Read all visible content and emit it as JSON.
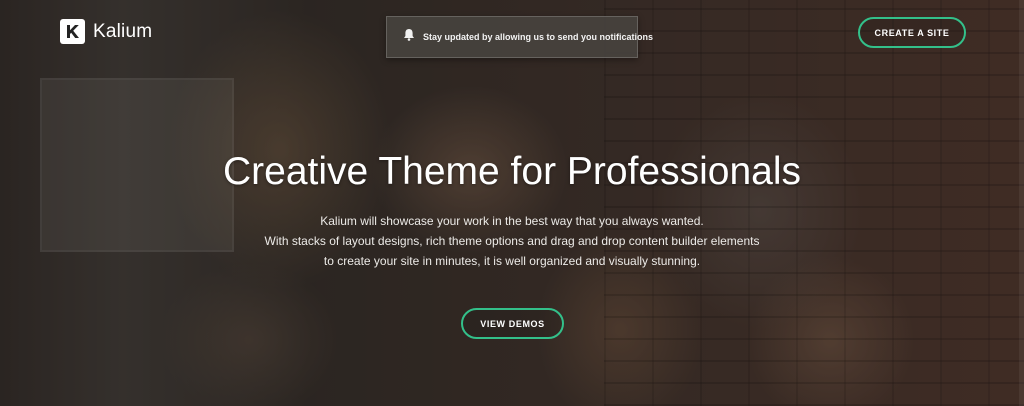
{
  "header": {
    "logo_text": "Kalium",
    "logo_icon": "kalium-k-icon",
    "create_site_label": "CREATE A SITE"
  },
  "notification": {
    "icon": "bell-icon",
    "text": "Stay updated by allowing us to send you notifications"
  },
  "hero": {
    "title": "Creative Theme for Professionals",
    "description_lines": [
      "Kalium will showcase your work in the best way that you always wanted.",
      "With stacks of layout designs, rich theme options and drag and drop content builder elements",
      "to create your site in minutes, it is well organized and visually stunning."
    ],
    "cta_label": "VIEW DEMOS"
  },
  "colors": {
    "accent": "#33c08a",
    "text": "#ffffff",
    "notification_bg": "#46423e"
  }
}
